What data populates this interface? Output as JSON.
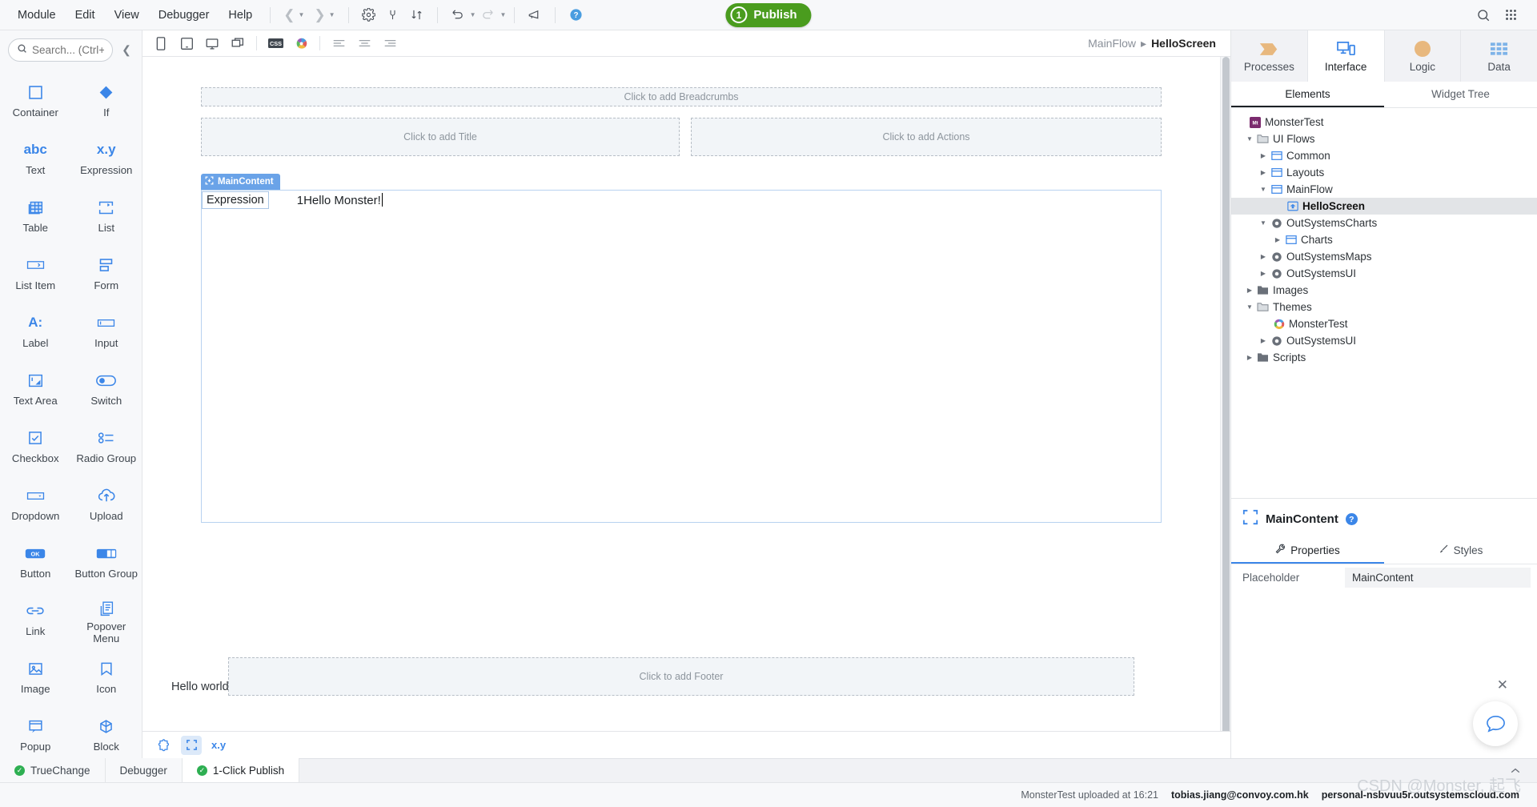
{
  "menubar": {
    "items": [
      "Module",
      "Edit",
      "View",
      "Debugger",
      "Help"
    ],
    "publish": {
      "label": "Publish",
      "count": "1",
      "color": "#4a9c1e"
    }
  },
  "toolbox": {
    "search_placeholder": "Search... (Ctrl+E)",
    "widgets": [
      {
        "label": "Container",
        "icon": "square-outline-icon"
      },
      {
        "label": "If",
        "icon": "diamond-icon"
      },
      {
        "label": "Text",
        "icon": "abc-icon",
        "glyph": "abc"
      },
      {
        "label": "Expression",
        "icon": "xy-icon",
        "glyph": "x.y"
      },
      {
        "label": "Table",
        "icon": "table-icon"
      },
      {
        "label": "List",
        "icon": "list-icon"
      },
      {
        "label": "List Item",
        "icon": "list-item-icon"
      },
      {
        "label": "Form",
        "icon": "form-icon"
      },
      {
        "label": "Label",
        "icon": "label-icon",
        "glyph": "A:"
      },
      {
        "label": "Input",
        "icon": "input-icon"
      },
      {
        "label": "Text Area",
        "icon": "textarea-icon"
      },
      {
        "label": "Switch",
        "icon": "switch-icon"
      },
      {
        "label": "Checkbox",
        "icon": "checkbox-icon"
      },
      {
        "label": "Radio Group",
        "icon": "radio-group-icon"
      },
      {
        "label": "Dropdown",
        "icon": "dropdown-icon"
      },
      {
        "label": "Upload",
        "icon": "upload-icon"
      },
      {
        "label": "Button",
        "icon": "button-icon",
        "glyph": "OK"
      },
      {
        "label": "Button Group",
        "icon": "button-group-icon"
      },
      {
        "label": "Link",
        "icon": "link-icon"
      },
      {
        "label": "Popover Menu",
        "icon": "popover-menu-icon"
      },
      {
        "label": "Image",
        "icon": "image-icon"
      },
      {
        "label": "Icon",
        "icon": "icon-icon"
      },
      {
        "label": "Popup",
        "icon": "popup-icon"
      },
      {
        "label": "Block",
        "icon": "block-icon"
      }
    ]
  },
  "canvas": {
    "breadcrumb": {
      "parent": "MainFlow",
      "current": "HelloScreen",
      "separator": "▸"
    },
    "placeholders": {
      "breadcrumbs": "Click to add Breadcrumbs",
      "title": "Click to add Title",
      "actions": "Click to add Actions",
      "footer": "Click to add Footer"
    },
    "main_content_tag": "MainContent",
    "expression_chip": "Expression",
    "expression_value": "1Hello Monster!",
    "hello_world": "Hello world",
    "strip_xy": "x.y"
  },
  "right_panel": {
    "tabs": [
      {
        "label": "Processes",
        "icon": "processes-icon",
        "active": false
      },
      {
        "label": "Interface",
        "icon": "interface-icon",
        "active": true
      },
      {
        "label": "Logic",
        "icon": "logic-icon",
        "active": false
      },
      {
        "label": "Data",
        "icon": "data-icon",
        "active": false
      }
    ],
    "subtabs": [
      {
        "label": "Elements",
        "active": true
      },
      {
        "label": "Widget Tree",
        "active": false
      }
    ],
    "tree": [
      {
        "label": "MonsterTest",
        "indent": 0,
        "twisty": "none",
        "icon": "module-icon",
        "selected": false
      },
      {
        "label": "UI Flows",
        "indent": 1,
        "twisty": "open",
        "icon": "folder-open-icon",
        "selected": false
      },
      {
        "label": "Common",
        "indent": 2,
        "twisty": "closed",
        "icon": "flow-icon",
        "selected": false
      },
      {
        "label": "Layouts",
        "indent": 2,
        "twisty": "closed",
        "icon": "flow-icon",
        "selected": false
      },
      {
        "label": "MainFlow",
        "indent": 2,
        "twisty": "open",
        "icon": "flow-icon",
        "selected": false
      },
      {
        "label": "HelloScreen",
        "indent": 3,
        "twisty": "none",
        "icon": "screen-icon",
        "selected": true
      },
      {
        "label": "OutSystemsCharts",
        "indent": 2,
        "twisty": "open",
        "icon": "module-ref-icon",
        "selected": false
      },
      {
        "label": "Charts",
        "indent": 3,
        "twisty": "closed",
        "icon": "flow-icon",
        "selected": false
      },
      {
        "label": "OutSystemsMaps",
        "indent": 2,
        "twisty": "closed",
        "icon": "module-ref-icon",
        "selected": false
      },
      {
        "label": "OutSystemsUI",
        "indent": 2,
        "twisty": "closed",
        "icon": "module-ref-icon",
        "selected": false
      },
      {
        "label": "Images",
        "indent": 1,
        "twisty": "closed",
        "icon": "folder-icon",
        "selected": false
      },
      {
        "label": "Themes",
        "indent": 1,
        "twisty": "open",
        "icon": "folder-open-icon",
        "selected": false
      },
      {
        "label": "MonsterTest",
        "indent": 2,
        "twisty": "none",
        "icon": "theme-icon",
        "selected": false
      },
      {
        "label": "OutSystemsUI",
        "indent": 2,
        "twisty": "closed",
        "icon": "module-ref-icon",
        "selected": false
      },
      {
        "label": "Scripts",
        "indent": 1,
        "twisty": "closed",
        "icon": "folder-icon",
        "selected": false
      }
    ],
    "properties": {
      "title": "MainContent",
      "help": "?",
      "tabs": [
        {
          "label": "Properties",
          "icon": "wrench-icon",
          "active": true
        },
        {
          "label": "Styles",
          "icon": "brush-icon",
          "active": false
        }
      ],
      "rows": [
        {
          "label": "Placeholder",
          "value": "MainContent"
        }
      ]
    }
  },
  "bottom": {
    "tabs": [
      {
        "label": "TrueChange",
        "status": "ok",
        "active": false
      },
      {
        "label": "Debugger",
        "status": "none",
        "active": false
      },
      {
        "label": "1-Click Publish",
        "status": "ok",
        "active": true
      }
    ],
    "status": {
      "upload_text": "MonsterTest uploaded at 16:21",
      "user": "tobias.jiang@convoy.com.hk",
      "environment": "personal-nsbvuu5r.outsystemscloud.com"
    },
    "watermark": "CSDN @Monster, 起飞"
  }
}
